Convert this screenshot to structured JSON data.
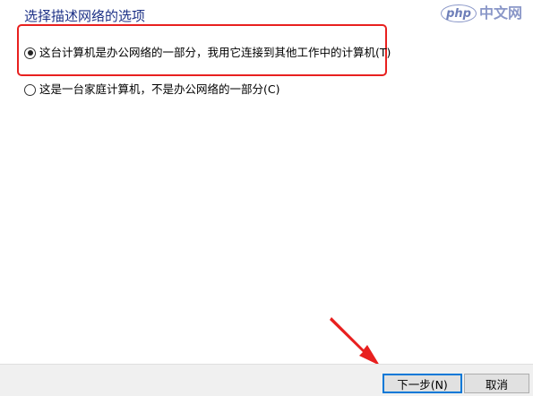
{
  "dialog": {
    "heading": "选择描述网络的选项"
  },
  "watermark": {
    "badge": "php",
    "text": "中文网"
  },
  "options": [
    {
      "label": "这台计算机是办公网络的一部分，我用它连接到其他工作中的计算机(T)",
      "checked": true
    },
    {
      "label": "这是一台家庭计算机，不是办公网络的一部分(C)",
      "checked": false
    }
  ],
  "footer": {
    "next_label": "下一步(N)",
    "cancel_label": "取消"
  },
  "colors": {
    "heading": "#1e3287",
    "highlight": "#e8201f",
    "arrow": "#e8201f",
    "focus": "#0078d7"
  }
}
